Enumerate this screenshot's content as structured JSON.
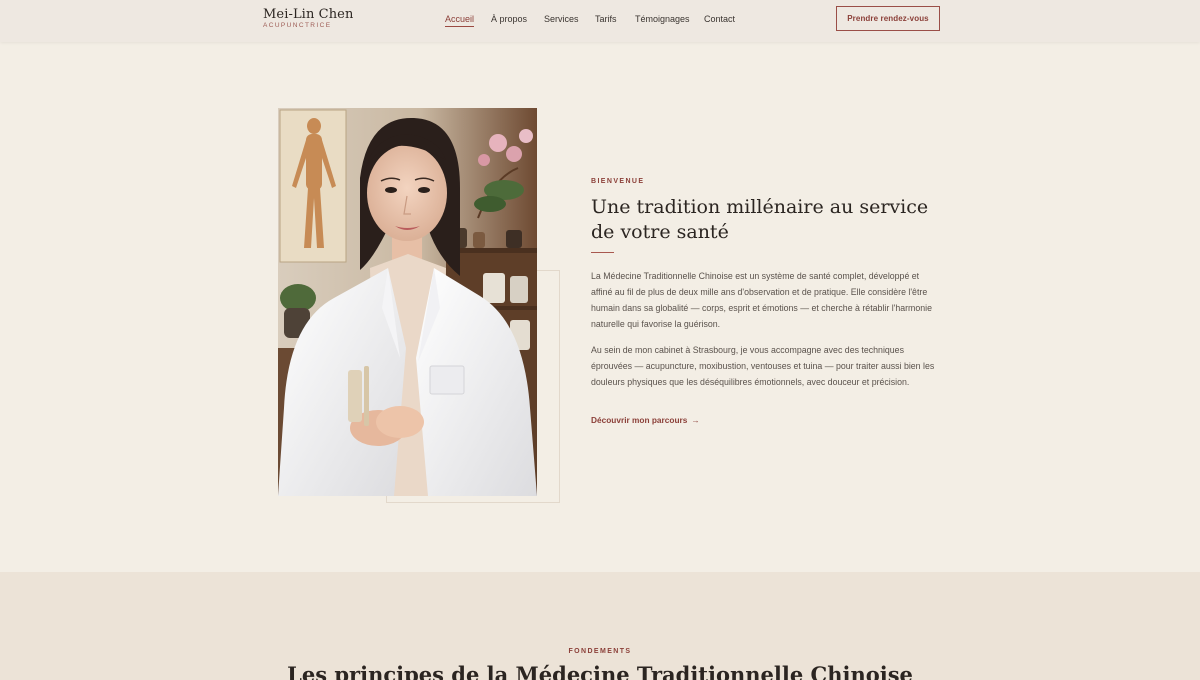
{
  "header": {
    "logo_name": "Mei-Lin Chen",
    "logo_subtitle": "ACUPUNCTRICE",
    "nav": [
      {
        "label": "Accueil",
        "active": true
      },
      {
        "label": "À propos",
        "active": false
      },
      {
        "label": "Services",
        "active": false
      },
      {
        "label": "Tarifs",
        "active": false
      },
      {
        "label": "Témoignages",
        "active": false
      },
      {
        "label": "Contact",
        "active": false
      }
    ],
    "cta_label": "Prendre rendez-vous"
  },
  "hero": {
    "eyebrow": "BIENVENUE",
    "title": "Une tradition millénaire au service de votre santé",
    "paragraph1": "La Médecine Traditionnelle Chinoise est un système de santé complet, développé et affiné au fil de plus de deux mille ans d'observation et de pratique. Elle considère l'être humain dans sa globalité — corps, esprit et émotions — et cherche à rétablir l'harmonie naturelle qui favorise la guérison.",
    "paragraph2": "Au sein de mon cabinet à Strasbourg, je vous accompagne avec des techniques éprouvées — acupuncture, moxibustion, ventouses et tuina — pour traiter aussi bien les douleurs physiques que les déséquilibres émotionnels, avec douceur et précision.",
    "link_label": "Découvrir mon parcours",
    "link_arrow": "→"
  },
  "section2": {
    "eyebrow": "FONDEMENTS",
    "title": "Les principes de la Médecine Traditionnelle Chinoise"
  },
  "colors": {
    "accent": "#8b3f38",
    "background": "#f3eee5",
    "section_background": "#ece3d7",
    "header_background": "#eee8e1"
  }
}
